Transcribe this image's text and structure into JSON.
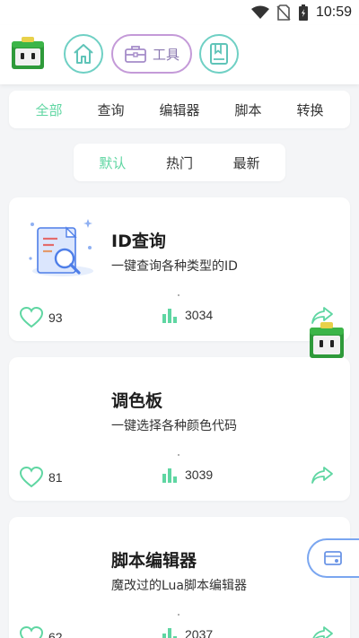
{
  "status_bar": {
    "time": "10:59"
  },
  "app_bar": {
    "logo_icon": "mascot-logo-icon",
    "nav": [
      {
        "icon": "home-icon"
      },
      {
        "icon": "toolbox-icon",
        "label": "工具"
      },
      {
        "icon": "bookmark-book-icon"
      }
    ]
  },
  "categories": {
    "items": [
      "全部",
      "查询",
      "编辑器",
      "脚本",
      "转换"
    ],
    "active": "全部"
  },
  "sort": {
    "items": [
      "默认",
      "热门",
      "最新"
    ],
    "active": "默认"
  },
  "tools": [
    {
      "title": "ID查询",
      "description": "一键查询各种类型的ID",
      "likes": "93",
      "views": "3034"
    },
    {
      "title": "调色板",
      "description": "一键选择各种颜色代码",
      "likes": "81",
      "views": "3039"
    },
    {
      "title": "脚本编辑器",
      "description": "魔改过的Lua脚本编辑器",
      "likes": "62",
      "views": "2037"
    }
  ],
  "colors": {
    "accent": "#5fd6a2",
    "nav_border": "#6fd0c4",
    "pill_border": "#c49ad8",
    "float_border": "#7aa6f0",
    "logo_green": "#2e9a3a"
  }
}
